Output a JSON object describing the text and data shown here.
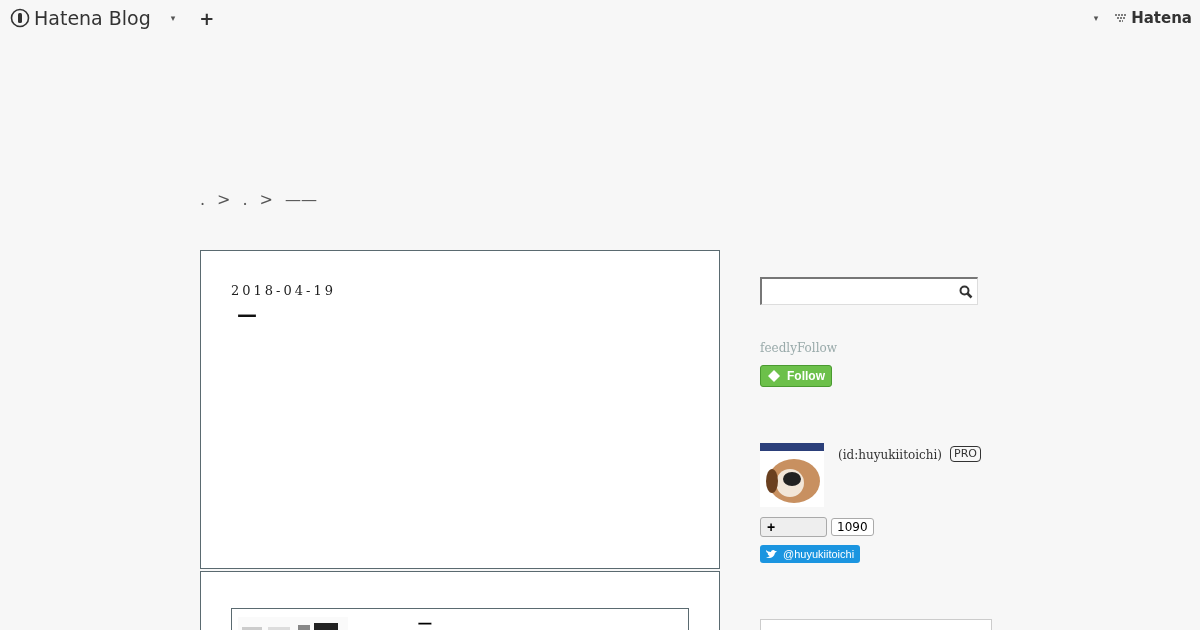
{
  "header": {
    "logo": "Hatena Blog",
    "caret": "▾",
    "add": "+",
    "right_caret": "▾",
    "brand": "Hatena"
  },
  "breadcrumb": {
    "items": [
      ".",
      ".",
      "——"
    ],
    "separator": ">"
  },
  "entry": {
    "date": "2018-04-19",
    "title": "—"
  },
  "embed": {
    "title": "一"
  },
  "sidebar": {
    "feedly_label": "feedlyFollow",
    "follow_button": "Follow",
    "profile": {
      "id": "(id:huyukiitoichi)",
      "badge": "PRO",
      "add": "+",
      "count": "1090",
      "twitter": "@huyukiitoichi"
    }
  }
}
